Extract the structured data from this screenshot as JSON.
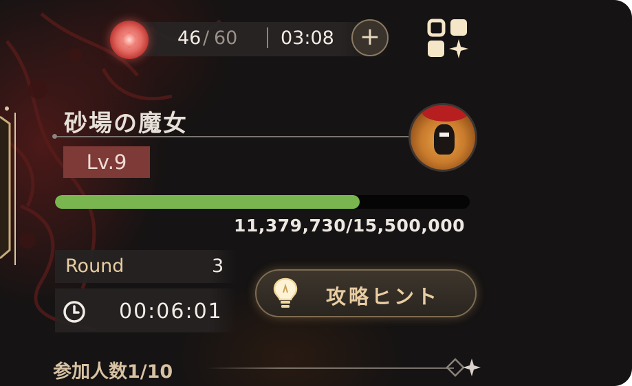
{
  "stamina": {
    "current": "46",
    "separator": "/",
    "max": "60",
    "recover_timer": "03:08",
    "add_label": "+"
  },
  "boss": {
    "name": "砂場の魔女",
    "level": "Lv.9",
    "hp_text": "11,379,730/15,500,000",
    "hp_ratio": 0.7342
  },
  "battle": {
    "round_label": "Round",
    "round_value": "3",
    "elapsed_time": "00:06:01"
  },
  "hint_button": {
    "label": "攻略ヒント"
  },
  "participants": {
    "label": "参加人数1/10"
  },
  "icons": {
    "stamina": "stamina-gem-icon",
    "add": "plus-icon",
    "menu": "menu-grid-icon",
    "clock": "clock-icon",
    "hint": "lightbulb-icon",
    "decor": "sparkle-icon"
  },
  "colors": {
    "hp_fill": "#7ab64f",
    "level_badge": "#7e3a36",
    "accent_gold": "#e8cda3",
    "stamina_red": "#e46a62"
  }
}
